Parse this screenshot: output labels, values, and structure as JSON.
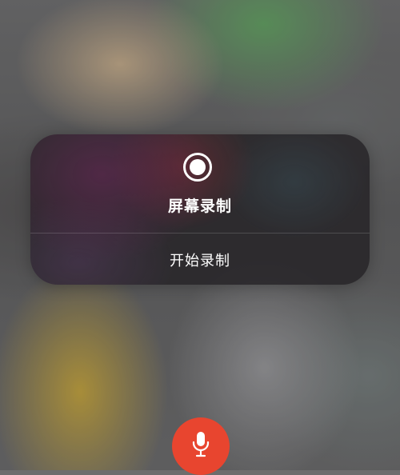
{
  "screen_recording": {
    "title": "屏幕录制",
    "start_label": "开始录制",
    "icon": "record-icon"
  },
  "microphone": {
    "icon": "microphone-icon",
    "state": "on",
    "color": "#e8452f"
  }
}
